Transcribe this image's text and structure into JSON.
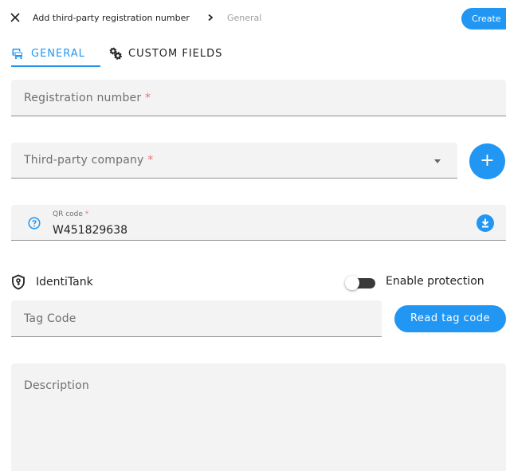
{
  "header": {
    "close_icon": "close-icon",
    "title": "Add third-party registration number",
    "chevron_icon": "chevron-right-icon",
    "current": "General",
    "create_label": "Create"
  },
  "tabs": [
    {
      "label": "GENERAL",
      "icon": "car-icon",
      "active": true
    },
    {
      "label": "CUSTOM FIELDS",
      "icon": "gears-icon",
      "active": false
    }
  ],
  "form": {
    "registration": {
      "label": "Registration number",
      "required": "*"
    },
    "company": {
      "label": "Third-party company",
      "required": "*"
    },
    "add_icon": "plus-icon",
    "qr": {
      "label": "QR code",
      "required": "*",
      "value": "W451829638",
      "help_icon": "question-circle-icon",
      "action_icon": "download-icon"
    },
    "identitank": {
      "label": "IdentiTank",
      "icon": "shield-key-icon"
    },
    "protection": {
      "label": "Enable protection",
      "enabled": false
    },
    "tag": {
      "label": "Tag Code"
    },
    "read_tag": {
      "label": "Read tag code"
    },
    "description": {
      "label": "Description"
    }
  },
  "colors": {
    "accent": "#2196f3",
    "required": "#e57373",
    "field_bg": "#f3f3f3"
  }
}
